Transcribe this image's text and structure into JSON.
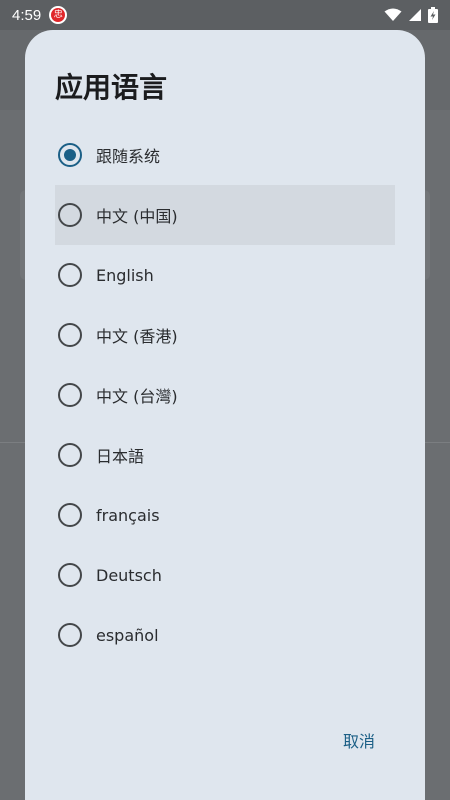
{
  "status_bar": {
    "time": "4:59",
    "app_badge_text": "忠",
    "icons": [
      "wifi-icon",
      "cellular-signal-icon",
      "battery-charging-icon"
    ]
  },
  "dialog": {
    "title": "应用语言",
    "selected_index": 0,
    "options": [
      {
        "label": "跟随系统",
        "selected": true
      },
      {
        "label": "中文 (中国)",
        "selected": false
      },
      {
        "label": "English",
        "selected": false
      },
      {
        "label": "中文 (香港)",
        "selected": false
      },
      {
        "label": "中文 (台灣)",
        "selected": false
      },
      {
        "label": "日本語",
        "selected": false
      },
      {
        "label": "français",
        "selected": false
      },
      {
        "label": "Deutsch",
        "selected": false
      },
      {
        "label": "español",
        "selected": false
      }
    ],
    "cancel_label": "取消"
  },
  "colors": {
    "dialog_bg": "#dfe6ee",
    "accent": "#1b5f86",
    "scrim": "#6a6d70"
  }
}
